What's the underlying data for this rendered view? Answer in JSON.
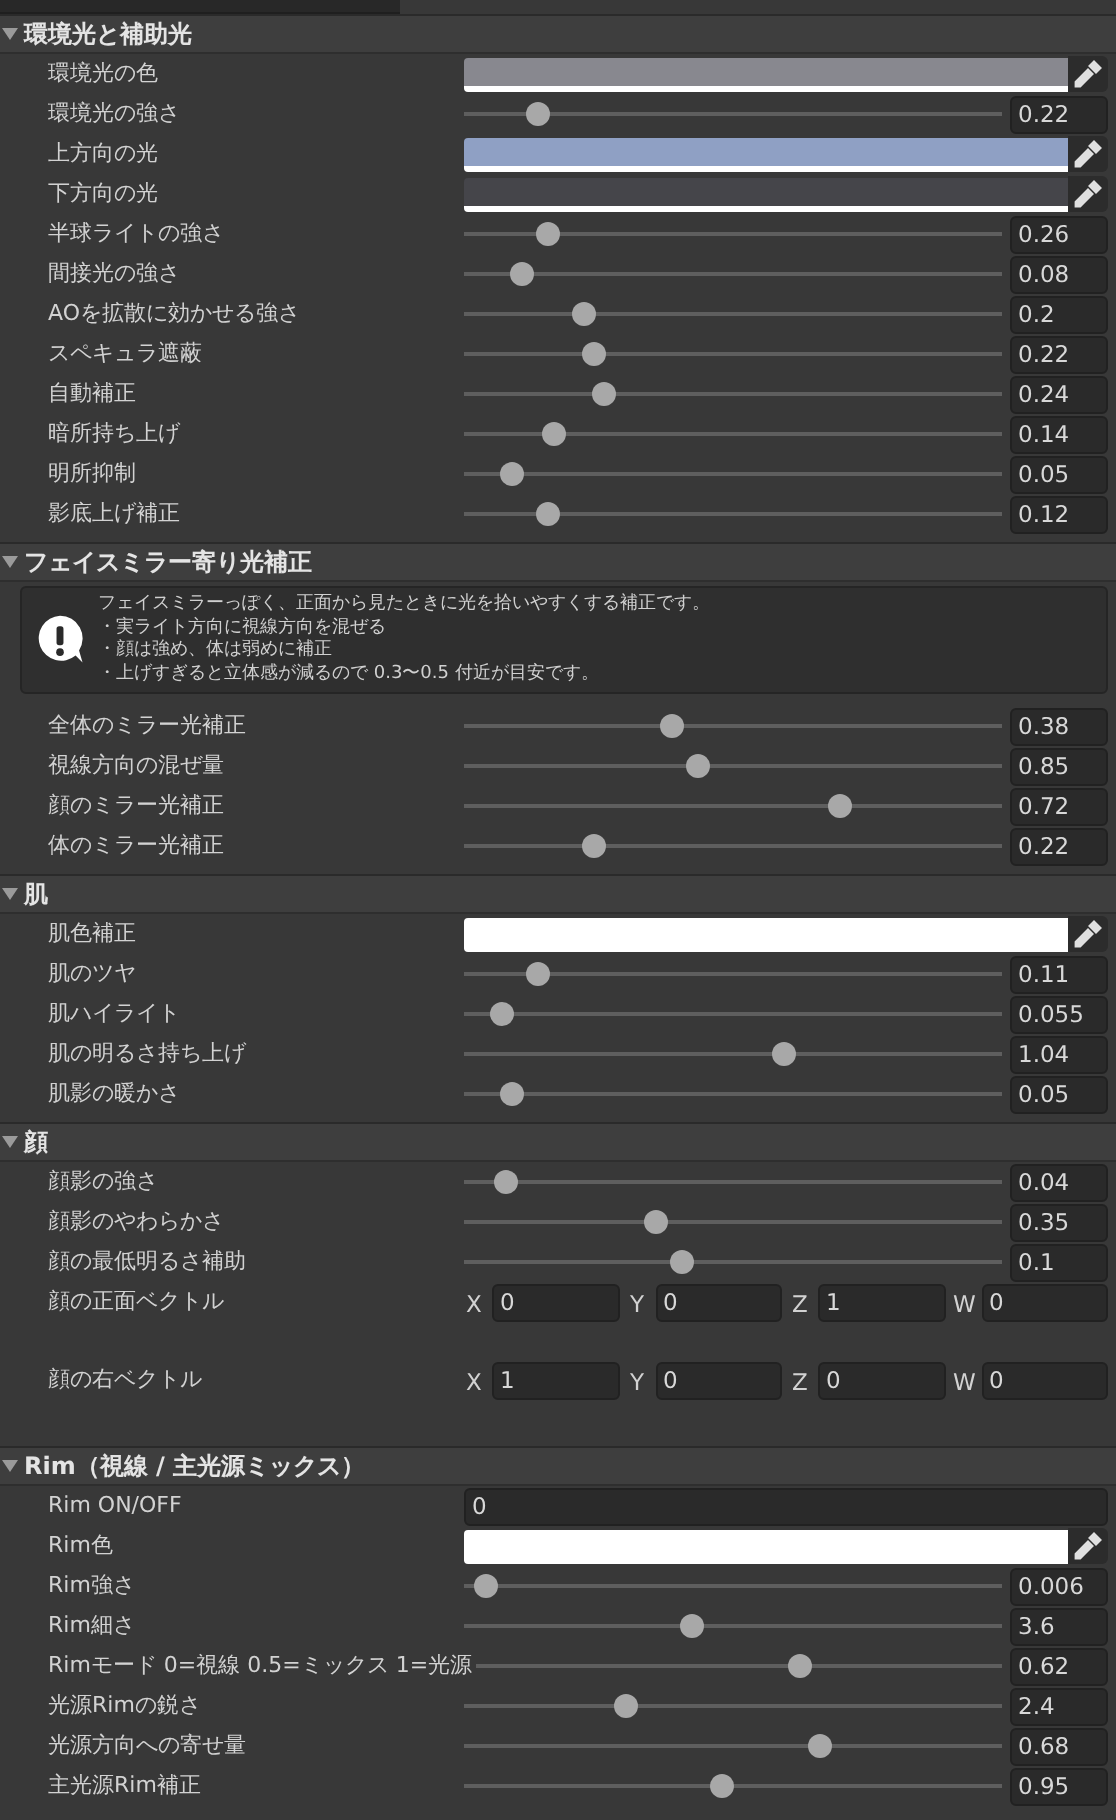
{
  "sections": [
    {
      "title": "環境光と補助光",
      "expanded": true,
      "rows": [
        {
          "kind": "color",
          "label": "環境光の色",
          "color": "#88888f"
        },
        {
          "kind": "slider",
          "label": "環境光の強さ",
          "level": 0.12,
          "value": "0.22"
        },
        {
          "kind": "color",
          "label": "上方向の光",
          "color": "#8fa0c4"
        },
        {
          "kind": "color",
          "label": "下方向の光",
          "color": "#45454a"
        },
        {
          "kind": "slider",
          "label": "半球ライトの強さ",
          "level": 0.14,
          "value": "0.26"
        },
        {
          "kind": "slider",
          "label": "間接光の強さ",
          "level": 0.09,
          "value": "0.08"
        },
        {
          "kind": "slider",
          "label": "AOを拡散に効かせる強さ",
          "level": 0.21,
          "value": "0.2"
        },
        {
          "kind": "slider",
          "label": "スペキュラ遮蔽",
          "level": 0.23,
          "value": "0.22"
        },
        {
          "kind": "slider",
          "label": "自動補正",
          "level": 0.25,
          "value": "0.24"
        },
        {
          "kind": "slider",
          "label": "暗所持ち上げ",
          "level": 0.15,
          "value": "0.14"
        },
        {
          "kind": "slider",
          "label": "明所抑制",
          "level": 0.07,
          "value": "0.05"
        },
        {
          "kind": "slider",
          "label": "影底上げ補正",
          "level": 0.14,
          "value": "0.12"
        }
      ]
    },
    {
      "title": "フェイスミラー寄り光補正",
      "expanded": true,
      "help": [
        "フェイスミラーっぽく、正面から見たときに光を拾いやすくする補正です。",
        "・実ライト方向に視線方向を混ぜる",
        "・顔は強め、体は弱めに補正",
        "・上げすぎると立体感が減るので 0.3〜0.5 付近が目安です。"
      ],
      "rows": [
        {
          "kind": "slider",
          "label": "全体のミラー光補正",
          "level": 0.38,
          "value": "0.38"
        },
        {
          "kind": "slider",
          "label": "視線方向の混ぜ量",
          "level": 0.43,
          "value": "0.85"
        },
        {
          "kind": "slider",
          "label": "顔のミラー光補正",
          "level": 0.71,
          "value": "0.72"
        },
        {
          "kind": "slider",
          "label": "体のミラー光補正",
          "level": 0.23,
          "value": "0.22"
        }
      ]
    },
    {
      "title": "肌",
      "expanded": true,
      "rows": [
        {
          "kind": "color",
          "label": "肌色補正",
          "color": "#ffffff"
        },
        {
          "kind": "slider",
          "label": "肌のツヤ",
          "level": 0.12,
          "value": "0.11"
        },
        {
          "kind": "slider",
          "label": "肌ハイライト",
          "level": 0.05,
          "value": "0.055"
        },
        {
          "kind": "slider",
          "label": "肌の明るさ持ち上げ",
          "level": 0.6,
          "value": "1.04"
        },
        {
          "kind": "slider",
          "label": "肌影の暖かさ",
          "level": 0.07,
          "value": "0.05"
        }
      ]
    },
    {
      "title": "顔",
      "expanded": true,
      "rows": [
        {
          "kind": "slider",
          "label": "顔影の強さ",
          "level": 0.06,
          "value": "0.04"
        },
        {
          "kind": "slider",
          "label": "顔影のやわらかさ",
          "level": 0.35,
          "value": "0.35"
        },
        {
          "kind": "slider",
          "label": "顔の最低明るさ補助",
          "level": 0.4,
          "value": "0.1"
        },
        {
          "kind": "vector",
          "label": "顔の正面ベクトル",
          "components": [
            {
              "axis": "X",
              "value": "0"
            },
            {
              "axis": "Y",
              "value": "0"
            },
            {
              "axis": "Z",
              "value": "1"
            },
            {
              "axis": "W",
              "value": "0"
            }
          ]
        },
        {
          "kind": "vector",
          "label": "顔の右ベクトル",
          "components": [
            {
              "axis": "X",
              "value": "1"
            },
            {
              "axis": "Y",
              "value": "0"
            },
            {
              "axis": "Z",
              "value": "0"
            },
            {
              "axis": "W",
              "value": "0"
            }
          ]
        }
      ]
    },
    {
      "title": "Rim（視線 / 主光源ミックス）",
      "expanded": true,
      "rows": [
        {
          "kind": "number",
          "label": "Rim ON/OFF",
          "value": "0"
        },
        {
          "kind": "color",
          "label": "Rim色",
          "color": "#ffffff"
        },
        {
          "kind": "slider",
          "label": "Rim強さ",
          "level": 0.02,
          "value": "0.006"
        },
        {
          "kind": "slider",
          "label": "Rim細さ",
          "level": 0.42,
          "value": "3.6"
        },
        {
          "kind": "slider",
          "label": "Rimモード 0=視線 0.5=ミックス 1=光源",
          "level": 0.62,
          "value": "0.62"
        },
        {
          "kind": "slider",
          "label": "光源Rimの鋭さ",
          "level": 0.29,
          "value": "2.4"
        },
        {
          "kind": "slider",
          "label": "光源方向への寄せ量",
          "level": 0.67,
          "value": "0.68"
        },
        {
          "kind": "slider",
          "label": "主光源Rim補正",
          "level": 0.48,
          "value": "0.95"
        }
      ]
    }
  ]
}
